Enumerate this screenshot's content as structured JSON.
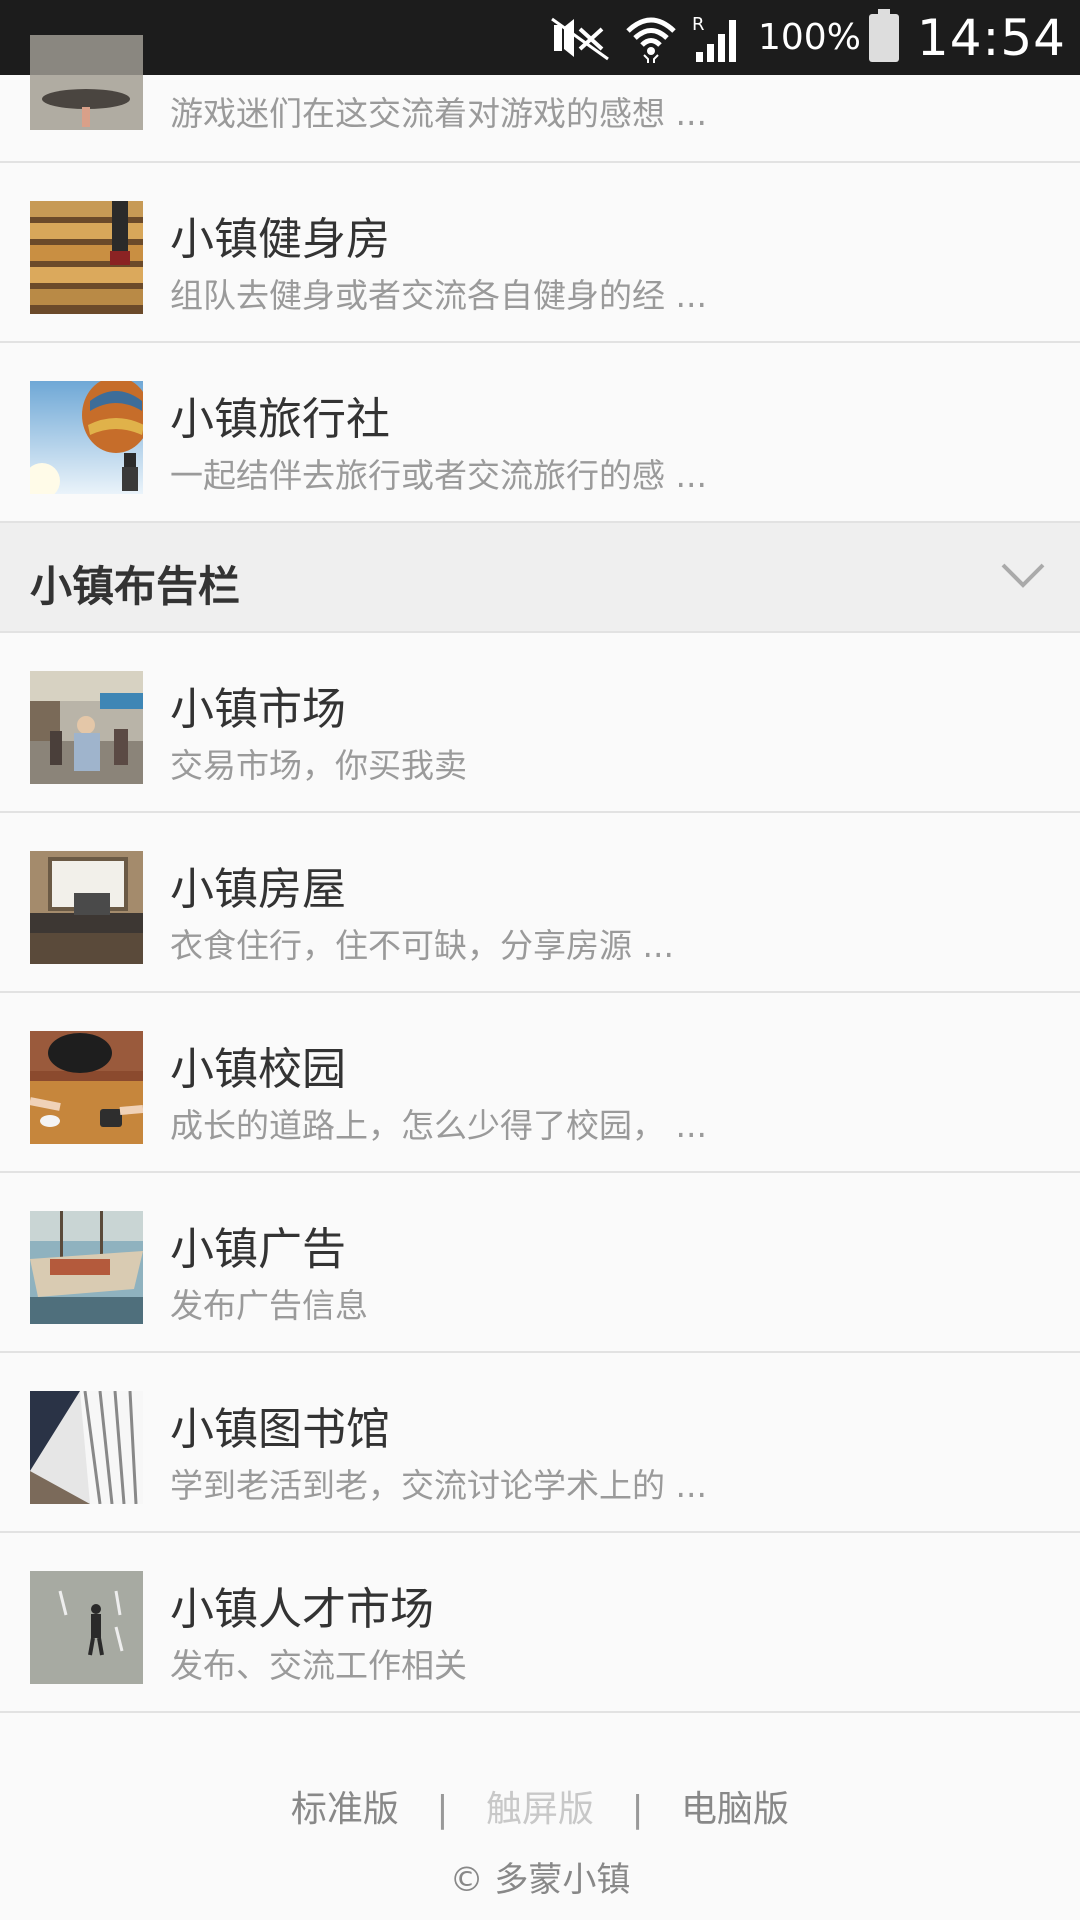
{
  "status_bar": {
    "battery_percent": "100%",
    "time": "14:54",
    "icons": [
      "mute-icon",
      "wifi-icon",
      "signal-icon",
      "battery-icon"
    ]
  },
  "partial_item": {
    "description": "游戏迷们在这交流着对游戏的感想 ..."
  },
  "items_top": [
    {
      "title": "小镇健身房",
      "description": "组队去健身或者交流各自健身的经 ...",
      "icon": "gym-stairs-image"
    },
    {
      "title": "小镇旅行社",
      "description": "一起结伴去旅行或者交流旅行的感 ...",
      "icon": "hot-air-balloon-image"
    }
  ],
  "section": {
    "title": "小镇布告栏",
    "toggle_icon": "chevron-down-icon"
  },
  "items_section": [
    {
      "title": "小镇市场",
      "description": "交易市场，你买我卖",
      "icon": "market-street-image"
    },
    {
      "title": "小镇房屋",
      "description": "衣食住行，住不可缺，分享房源 ...",
      "icon": "house-desk-image"
    },
    {
      "title": "小镇校园",
      "description": "成长的道路上，怎么少得了校园， ...",
      "icon": "campus-desk-image"
    },
    {
      "title": "小镇广告",
      "description": "发布广告信息",
      "icon": "boat-image"
    },
    {
      "title": "小镇图书馆",
      "description": "学到老活到老，交流讨论学术上的 ...",
      "icon": "library-building-image"
    },
    {
      "title": "小镇人才市场",
      "description": "发布、交流工作相关",
      "icon": "person-walking-image"
    }
  ],
  "footer": {
    "links": [
      "标准版",
      "触屏版",
      "电脑版"
    ],
    "separator": "|",
    "active_link": "触屏版",
    "copyright": "© 多蒙小镇"
  },
  "colors": {
    "status_bar_bg": "#1c1c1c",
    "page_bg": "#fafafa",
    "section_header_bg": "#efefef",
    "title_text": "#333333",
    "desc_text": "#9a9a9a"
  }
}
